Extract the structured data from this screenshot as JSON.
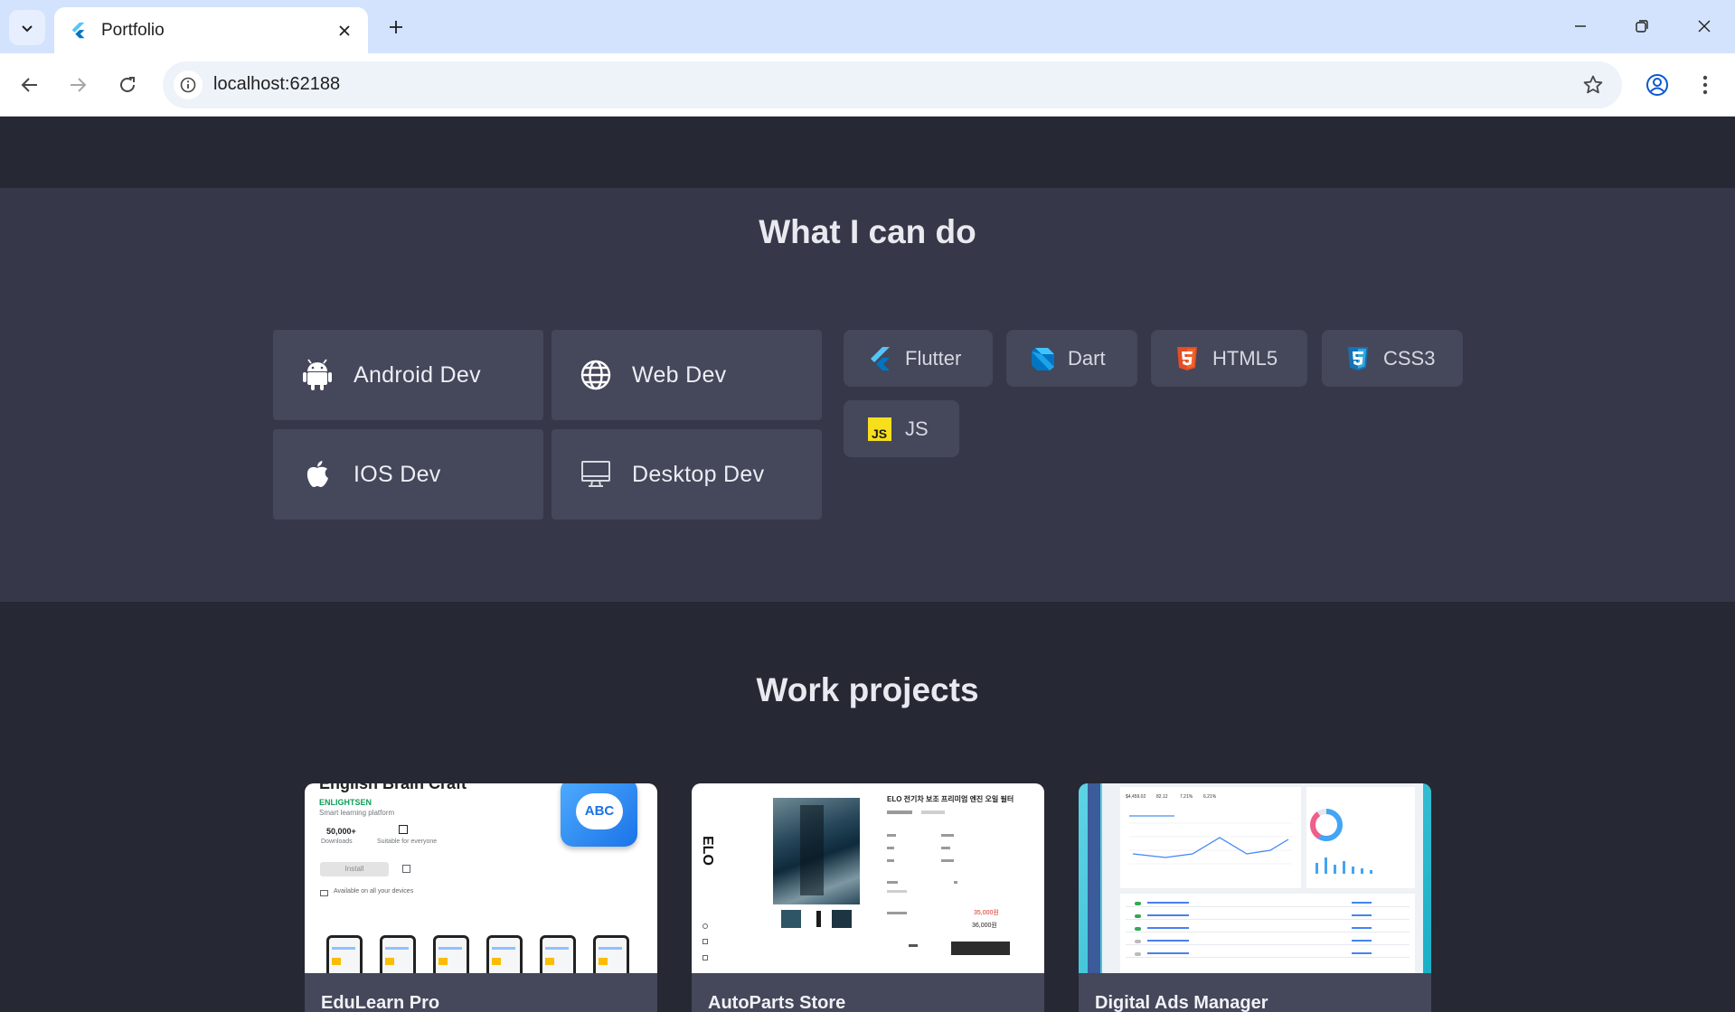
{
  "browser": {
    "tab_title": "Portfolio",
    "url": "localhost:62188"
  },
  "skills": {
    "title": "What I can do",
    "services": [
      {
        "label": "Android Dev",
        "icon": "android-icon"
      },
      {
        "label": "Web Dev",
        "icon": "globe-icon"
      },
      {
        "label": "IOS Dev",
        "icon": "apple-icon"
      },
      {
        "label": "Desktop Dev",
        "icon": "monitor-icon"
      }
    ],
    "tech": [
      {
        "label": "Flutter",
        "icon": "flutter-icon",
        "color": "#54c5f8"
      },
      {
        "label": "Dart",
        "icon": "dart-icon",
        "color": "#0175c2"
      },
      {
        "label": "HTML5",
        "icon": "html5-icon",
        "color": "#e44d26"
      },
      {
        "label": "CSS3",
        "icon": "css3-icon",
        "color": "#1572b6"
      },
      {
        "label": "JS",
        "icon": "javascript-icon",
        "color": "#f7df1e"
      }
    ]
  },
  "projects": {
    "title": "Work projects",
    "items": [
      {
        "title": "EduLearn Pro",
        "preview": {
          "app_name": "English Brain Craft",
          "brand": "ENLIGHTSEN",
          "tagline": "Smart learning platform",
          "downloads": "50,000+",
          "downloads_label": "Downloads",
          "rating_label": "Suitable for everyone",
          "install_label": "Install",
          "devices_label": "Available on all your devices",
          "logo_text": "ABC"
        }
      },
      {
        "title": "AutoParts Store",
        "preview": {
          "brand": "ELO",
          "product_title": "ELO 전기차 보조 프리미엄 엔진 오일 필터",
          "price": "35,000원",
          "total": "36,000원"
        }
      },
      {
        "title": "Digital Ads Manager",
        "preview": {
          "stat_1": "$4,459.02",
          "stat_2": "82.12",
          "stat_3": "7.21%",
          "stat_4": "6.21%"
        }
      }
    ]
  }
}
